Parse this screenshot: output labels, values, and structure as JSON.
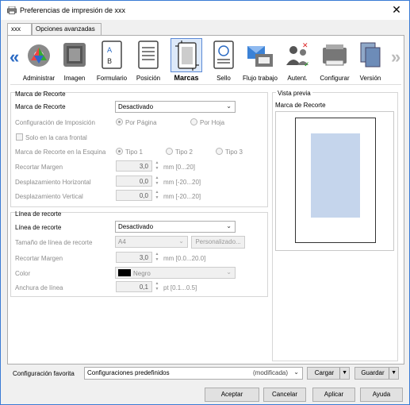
{
  "window": {
    "title": "Preferencias de impresión de xxx"
  },
  "tabs": [
    "xxx",
    "Opciones avanzadas"
  ],
  "toolbar": {
    "items": [
      "Administrar",
      "Imagen",
      "Formulario",
      "Posición",
      "Marcas",
      "Sello",
      "Flujo trabajo",
      "Autent.",
      "Configurar",
      "Versión"
    ],
    "selected": "Marcas"
  },
  "marca": {
    "group_title": "Marca de Recorte",
    "field_label": "Marca de Recorte",
    "field_value": "Desactivado",
    "imposicion_label": "Configuración de Imposición",
    "imposicion_opt1": "Por Página",
    "imposicion_opt2": "Por Hoja",
    "solo_cara_label": "Solo en la cara frontal",
    "esquina_label": "Marca de Recorte en la Esquina",
    "tipo1": "Tipo 1",
    "tipo2": "Tipo 2",
    "tipo3": "Tipo 3",
    "recortar_label": "Recortar Margen",
    "recortar_value": "3,0",
    "recortar_range": "mm [0...20]",
    "desp_h_label": "Desplazamiento Horizontal",
    "desp_h_value": "0,0",
    "desp_h_range": "mm [-20...20]",
    "desp_v_label": "Desplazamiento Vertical",
    "desp_v_value": "0,0",
    "desp_v_range": "mm [-20...20]"
  },
  "linea": {
    "group_title": "Línea de recorte",
    "field_label": "Línea de recorte",
    "field_value": "Desactivado",
    "tamano_label": "Tamaño de línea de recorte",
    "tamano_value": "A4",
    "personalizado_label": "Personalizado...",
    "recortar_label": "Recortar Margen",
    "recortar_value": "3,0",
    "recortar_range": "mm [0.0...20.0]",
    "color_label": "Color",
    "color_value": "Negro",
    "anchura_label": "Anchura de línea",
    "anchura_value": "0,1",
    "anchura_range": "pt [0.1...0.5]"
  },
  "preview": {
    "group_title": "Vista previa",
    "label": "Marca de Recorte"
  },
  "favorites": {
    "label": "Configuración favorita",
    "value": "Configuraciones predefinidos",
    "status": "(modificada)",
    "cargar": "Cargar",
    "guardar": "Guardar"
  },
  "footer": {
    "aceptar": "Aceptar",
    "cancelar": "Cancelar",
    "aplicar": "Aplicar",
    "ayuda": "Ayuda"
  },
  "colors": {
    "accent": "#2b6bc4",
    "selected_bg": "#dde9f9",
    "print_area": "#c5d5ec"
  }
}
